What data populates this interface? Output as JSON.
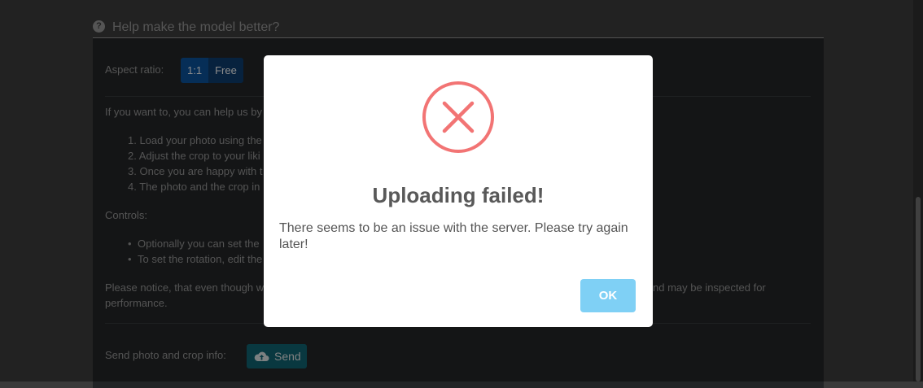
{
  "section": {
    "title": "Help make the model better?",
    "icon": "question-circle-icon"
  },
  "aspect_ratio": {
    "label": "Aspect ratio:",
    "options": [
      "1:1",
      "Free"
    ],
    "selected": "1:1"
  },
  "intro": "If you want to, you can help us by",
  "steps": [
    "1. Load your photo using the",
    "2. Adjust the crop to your liki",
    "3. Once you are happy with t",
    "4. The photo and the crop in"
  ],
  "controls": {
    "label": "Controls:",
    "items": [
      "Optionally you can set the",
      "To set the rotation, edit the"
    ]
  },
  "notice": {
    "line1_start": "Please notice, that even though w",
    "line1_end": "nd may be inspected for",
    "line2": "performance."
  },
  "send": {
    "label": "Send photo and crop info:",
    "button_label": "Send",
    "icon": "cloud-upload-icon",
    "color": "#0f5e6c"
  },
  "modal": {
    "icon": "error-x-icon",
    "icon_color": "#f27474",
    "title": "Uploading failed!",
    "message": "There seems to be an issue with the server. Please try again later!",
    "ok_label": "OK",
    "ok_color": "#7fd0f5"
  }
}
